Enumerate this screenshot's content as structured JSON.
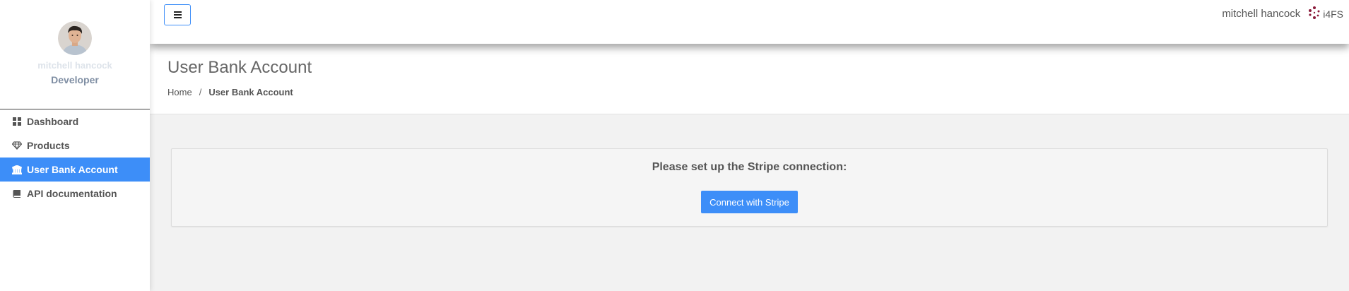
{
  "profile": {
    "name": "mitchell hancock",
    "role": "Developer"
  },
  "sidebar": {
    "items": [
      {
        "label": "Dashboard",
        "icon": "dashboard-grid-icon",
        "active": false
      },
      {
        "label": "Products",
        "icon": "diamond-icon",
        "active": false
      },
      {
        "label": "User Bank Account",
        "icon": "bank-icon",
        "active": true
      },
      {
        "label": "API documentation",
        "icon": "book-icon",
        "active": false
      }
    ]
  },
  "topbar": {
    "menu_icon": "hamburger-menu-icon",
    "username": "mitchell hancock",
    "brand_text": "i4FS",
    "brand_icon": "dots-logo-icon"
  },
  "header": {
    "title": "User Bank Account",
    "breadcrumb": {
      "home": "Home",
      "separator": "/",
      "current": "User Bank Account"
    }
  },
  "main": {
    "message": "Please set up the Stripe connection:",
    "button_label": "Connect with Stripe"
  },
  "colors": {
    "accent": "#3d8ef8",
    "brand_logo": "#8b1a3a"
  }
}
